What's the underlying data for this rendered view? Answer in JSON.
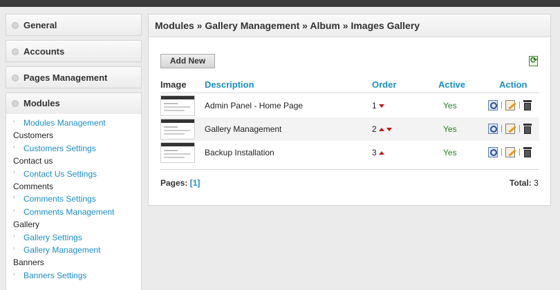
{
  "sidebar": {
    "sections": [
      "General",
      "Accounts",
      "Pages Management"
    ],
    "modules_title": "Modules",
    "modules_items": [
      {
        "type": "link",
        "label": "Modules Management"
      },
      {
        "type": "category",
        "label": "Customers"
      },
      {
        "type": "link",
        "label": "Customers Settings"
      },
      {
        "type": "category",
        "label": "Contact us"
      },
      {
        "type": "link",
        "label": "Contact Us Settings"
      },
      {
        "type": "category",
        "label": "Comments"
      },
      {
        "type": "link",
        "label": "Comments Settings"
      },
      {
        "type": "link",
        "label": "Comments Management"
      },
      {
        "type": "category",
        "label": "Gallery"
      },
      {
        "type": "link",
        "label": "Gallery Settings"
      },
      {
        "type": "link",
        "label": "Gallery Management"
      },
      {
        "type": "category",
        "label": "Banners"
      },
      {
        "type": "link",
        "label": "Banners Settings"
      }
    ]
  },
  "main": {
    "breadcrumb": "Modules » Gallery Management » Album » Images Gallery",
    "add_button": "Add New",
    "columns": {
      "image": "Image",
      "description": "Description",
      "order": "Order",
      "active": "Active",
      "action": "Action"
    },
    "rows": [
      {
        "description": "Admin Panel - Home Page",
        "order": "1",
        "arrows": [
          "down"
        ],
        "active": "Yes"
      },
      {
        "description": "Gallery Management",
        "order": "2",
        "arrows": [
          "up",
          "down"
        ],
        "active": "Yes"
      },
      {
        "description": "Backup Installation",
        "order": "3",
        "arrows": [
          "up"
        ],
        "active": "Yes"
      }
    ],
    "action_separator": "|",
    "pages_label": "Pages:",
    "pages_value": "[1]",
    "total_label": "Total:",
    "total_value": "3"
  }
}
